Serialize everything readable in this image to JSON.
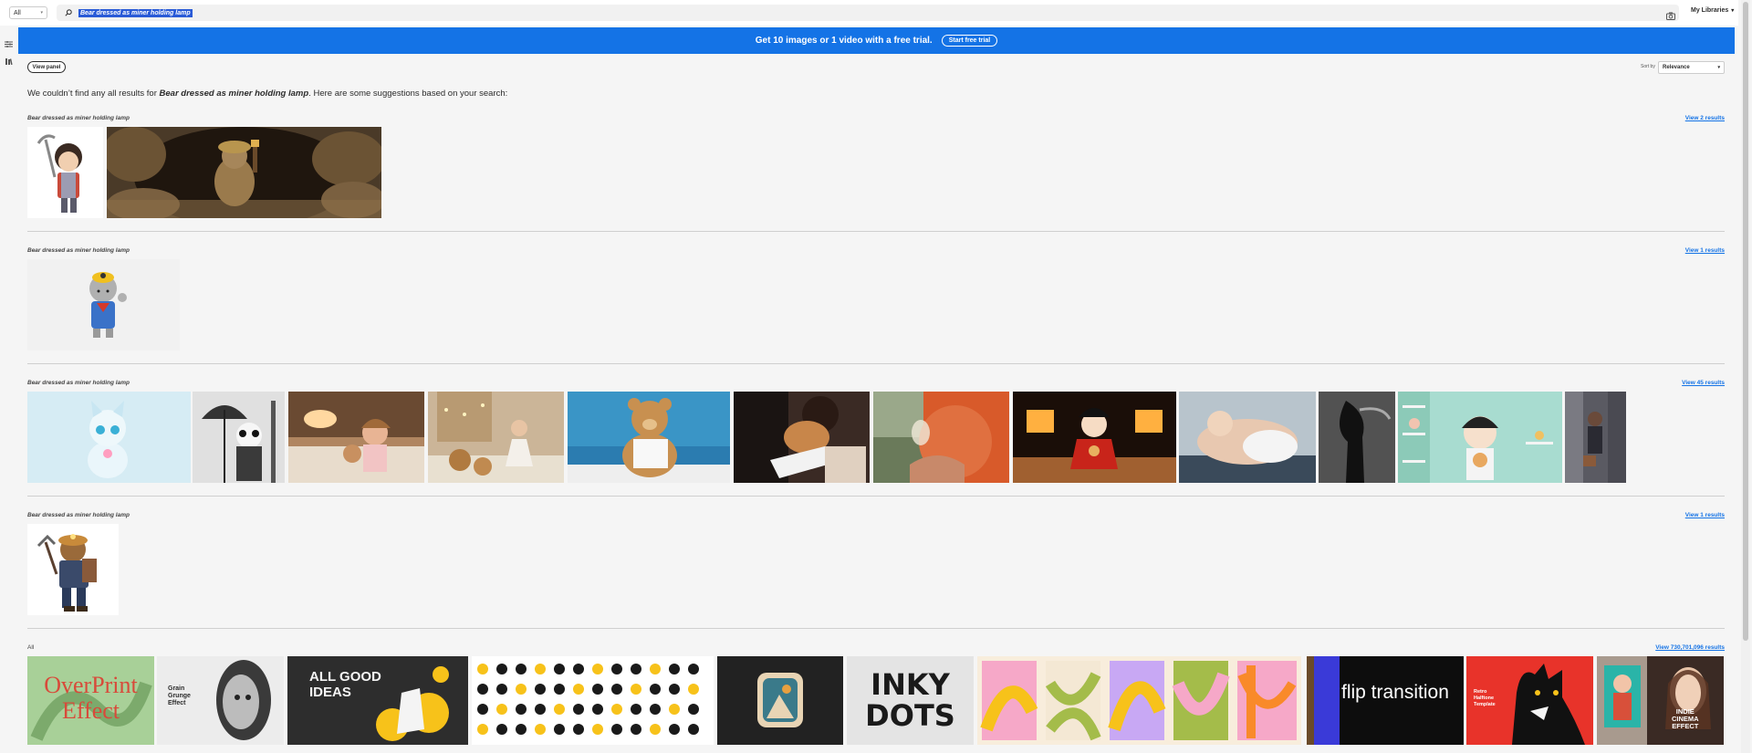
{
  "topbar": {
    "scope": "All",
    "search_value": "Bear dressed as miner holding lamp",
    "my_libraries": "My Libraries"
  },
  "banner": {
    "text": "Get 10 images or 1 video with a free trial.",
    "button": "Start free trial"
  },
  "toolbar": {
    "view_panel": "View panel",
    "sort_by_label": "Sort by",
    "sort_by_value": "Relevance"
  },
  "message": {
    "prefix": "We couldn’t find any all results for ",
    "query": "Bear dressed as miner holding lamp",
    "suffix": ". Here are some suggestions based on your search:"
  },
  "groups": [
    {
      "title": "Bear dressed as miner holding lamp",
      "link": "View 2 results"
    },
    {
      "title": "Bear dressed as miner holding lamp",
      "link": "View 1 results"
    },
    {
      "title": "Bear dressed as miner holding lamp",
      "link": "View 45 results"
    },
    {
      "title": "Bear dressed as miner holding lamp",
      "link": "View 1 results"
    },
    {
      "title": "All",
      "link": "View 730,701,096 results"
    }
  ],
  "all_thumbnails": {
    "overprint": [
      "OverPrint",
      "Effect"
    ],
    "grain": [
      "Grain",
      "Grunge",
      "Effect"
    ],
    "all_good_ideas": [
      "ALL GOOD",
      "IDEAS"
    ],
    "inky_dots": [
      "INKY",
      "DOTS"
    ],
    "flip_transition": "flip transition",
    "retro_halftone": [
      "Retro",
      "Halftone",
      "Template"
    ],
    "indie_cinema": [
      "INDIE",
      "CINEMA",
      "EFFECT"
    ]
  },
  "colors": {
    "banner": "#1473e6",
    "link": "#1473e6",
    "selection": "#2a5bd7"
  }
}
